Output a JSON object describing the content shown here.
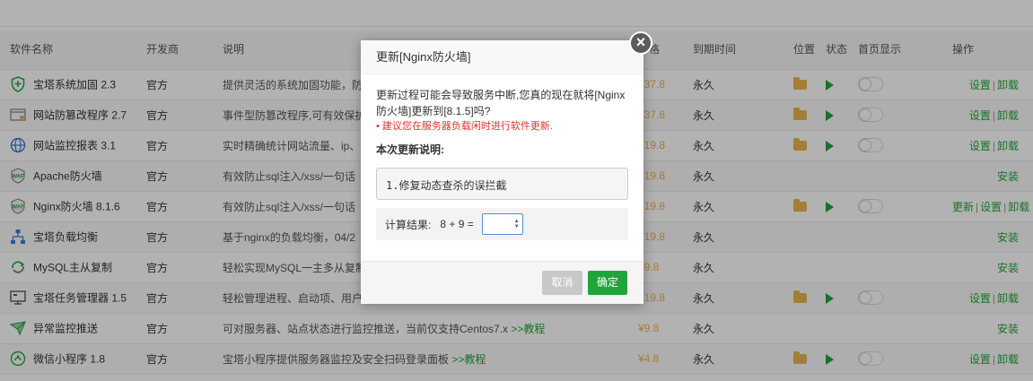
{
  "table": {
    "headers": {
      "name": "软件名称",
      "dev": "开发商",
      "desc": "说明",
      "price": "价格",
      "expire": "到期时间",
      "position": "位置",
      "position2": "置",
      "state": "状态",
      "state2": "态",
      "home": "首页显示",
      "home2": "示",
      "ops": "操作"
    },
    "rows": [
      {
        "name": "宝塔系统加固 2.3",
        "dev": "官方",
        "desc": "提供灵活的系统加固功能，防",
        "price": "¥37.8",
        "expire": "永久",
        "icon": "shield-icon",
        "actions": "setting-uninstall"
      },
      {
        "name": "网站防篡改程序 2.7",
        "dev": "官方",
        "desc": "事件型防篡改程序,可有效保护",
        "price": "¥37.8",
        "expire": "永久",
        "icon": "lock-window-icon",
        "actions": "setting-uninstall"
      },
      {
        "name": "网站监控报表 3.1",
        "dev": "官方",
        "desc": "实时精确统计网站流量、ip、",
        "price": "¥19.8",
        "expire": "永久",
        "icon": "globe-icon",
        "actions": "setting-uninstall"
      },
      {
        "name": "Apache防火墙",
        "dev": "官方",
        "desc": "有效防止sql注入/xss/一句话",
        "price": "¥19.8",
        "expire": "永久",
        "icon": "waf-icon",
        "actions": "install"
      },
      {
        "name": "Nginx防火墙 8.1.6",
        "dev": "官方",
        "desc": "有效防止sql注入/xss/一句话",
        "price": "¥19.8",
        "expire": "永久",
        "icon": "waf-icon",
        "actions": "update-setting-uninstall"
      },
      {
        "name": "宝塔负载均衡",
        "dev": "官方",
        "desc": "基于nginx的负载均衡，04/2",
        "price": "¥19.8",
        "expire": "永久",
        "icon": "network-icon",
        "actions": "install"
      },
      {
        "name": "MySQL主从复制",
        "dev": "官方",
        "desc": "轻松实现MySQL一主多从复制",
        "price": "¥9.8",
        "expire": "永久",
        "icon": "sync-icon",
        "actions": "install"
      },
      {
        "name": "宝塔任务管理器 1.5",
        "dev": "官方",
        "desc": "轻松管理进程、启动项、用户",
        "price": "¥19.8",
        "expire": "永久",
        "icon": "monitor-icon",
        "actions": "setting-uninstall"
      },
      {
        "name": "异常监控推送",
        "dev": "官方",
        "desc": "可对服务器、站点状态进行监控推送，当前仅支持Centos7.x",
        "desc_link": ">>教程",
        "price": "¥9.8",
        "expire": "永久",
        "icon": "mail-icon",
        "actions": "install"
      },
      {
        "name": "微信小程序 1.8",
        "dev": "官方",
        "desc": "宝塔小程序提供服务器监控及安全扫码登录面板",
        "desc_link": ">>教程",
        "price": "¥4.8",
        "expire": "永久",
        "icon": "wechat-icon",
        "actions": "setting-uninstall"
      }
    ],
    "labels": {
      "setting": "设置",
      "uninstall": "卸载",
      "install": "安装",
      "update": "更新",
      "sep": "|"
    }
  },
  "dialog": {
    "title": "更新[Nginx防火墙]",
    "close_label": "×",
    "msg_prefix": "更新过程可能会导致服务中断,您真的现在就将[Nginx防火墙]更新到",
    "msg_version": "[8.1.5]",
    "msg_suffix": "吗?",
    "warning": "建议您在服务器负载闲时进行软件更新.",
    "notes_heading": "本次更新说明:",
    "notes": "1.修复动态查杀的误拦截",
    "calc_label": "计算结果:",
    "calc_expr": "8 + 9 =",
    "calc_value": "",
    "cancel_label": "取消",
    "ok_label": "确定"
  },
  "colors": {
    "accent": "#20a53a",
    "price": "#f0ad4e",
    "highlight": "#e0332d"
  }
}
